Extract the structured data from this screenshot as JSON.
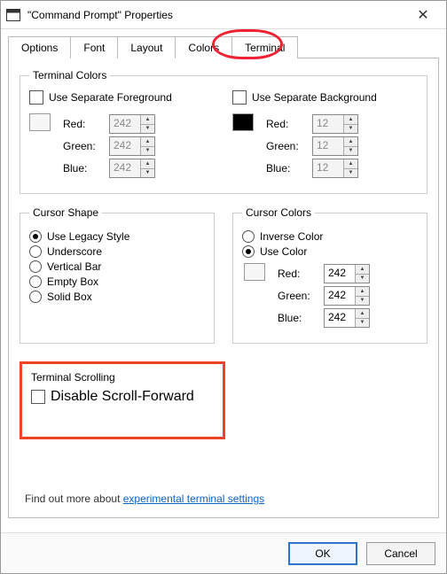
{
  "window": {
    "title": "\"Command Prompt\" Properties"
  },
  "tabs": {
    "items": [
      "Options",
      "Font",
      "Layout",
      "Colors",
      "Terminal"
    ],
    "active": "Terminal"
  },
  "terminal_colors": {
    "legend": "Terminal Colors",
    "fg": {
      "checkbox_label": "Use Separate Foreground",
      "checked": false,
      "enabled": false,
      "red_label": "Red:",
      "red": 242,
      "green_label": "Green:",
      "green": 242,
      "blue_label": "Blue:",
      "blue": 242
    },
    "bg": {
      "checkbox_label": "Use Separate Background",
      "checked": false,
      "enabled": false,
      "red_label": "Red:",
      "red": 12,
      "green_label": "Green:",
      "green": 12,
      "blue_label": "Blue:",
      "blue": 12
    }
  },
  "cursor_shape": {
    "legend": "Cursor Shape",
    "options": [
      "Use Legacy Style",
      "Underscore",
      "Vertical Bar",
      "Empty Box",
      "Solid Box"
    ],
    "selected": "Use Legacy Style"
  },
  "cursor_colors": {
    "legend": "Cursor Colors",
    "options": [
      "Inverse Color",
      "Use Color"
    ],
    "selected": "Use Color",
    "red_label": "Red:",
    "red": 242,
    "green_label": "Green:",
    "green": 242,
    "blue_label": "Blue:",
    "blue": 242
  },
  "terminal_scrolling": {
    "legend": "Terminal Scrolling",
    "checkbox_label": "Disable Scroll-Forward",
    "checked": false
  },
  "link": {
    "prefix": "Find out more about ",
    "text": "experimental terminal settings"
  },
  "buttons": {
    "ok": "OK",
    "cancel": "Cancel"
  }
}
